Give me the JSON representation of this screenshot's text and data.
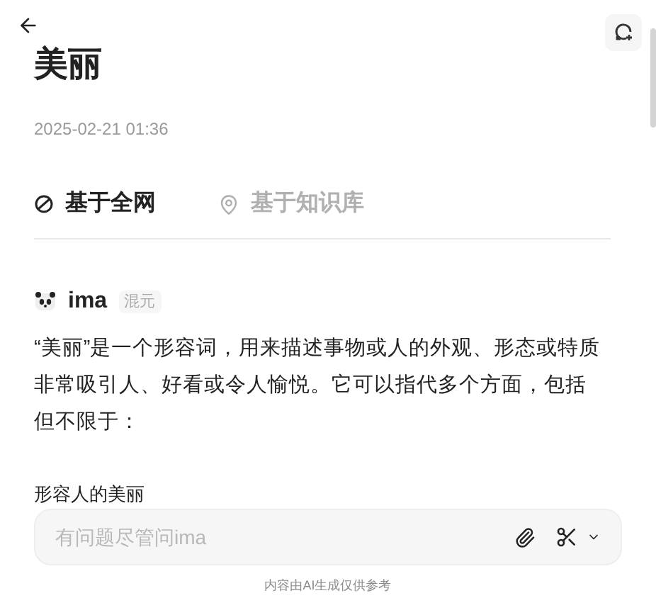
{
  "title": "美丽",
  "timestamp": "2025-02-21 01:36",
  "tabs": [
    {
      "label": "基于全网",
      "kind": "web",
      "selected": true
    },
    {
      "label": "基于知识库",
      "kind": "kb",
      "selected": false
    }
  ],
  "answer": {
    "author": "ima",
    "model": "混元",
    "paragraph": "“美丽”是一个形容词，用来描述事物或人的外观、形态或特质非常吸引人、好看或令人愉悦。它可以指代多个方面，包括但不限于：",
    "subheading": "形容人的美丽"
  },
  "input": {
    "placeholder": "有问题尽管问ima"
  },
  "footer": "内容由AI生成仅供参考"
}
